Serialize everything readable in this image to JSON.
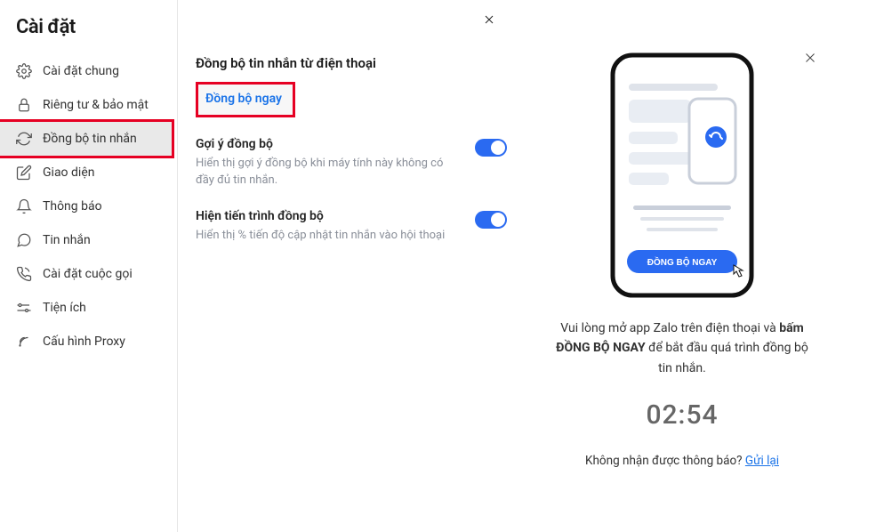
{
  "sidebar": {
    "title": "Cài đặt",
    "items": [
      {
        "label": "Cài đặt chung"
      },
      {
        "label": "Riêng tư & bảo mật"
      },
      {
        "label": "Đồng bộ tin nhắn"
      },
      {
        "label": "Giao diện"
      },
      {
        "label": "Thông báo"
      },
      {
        "label": "Tin nhắn"
      },
      {
        "label": "Cài đặt cuộc gọi"
      },
      {
        "label": "Tiện ích"
      },
      {
        "label": "Cấu hình Proxy"
      }
    ]
  },
  "main": {
    "heading": "Đồng bộ tin nhắn từ điện thoại",
    "sync_now_label": "Đồng bộ ngay",
    "suggest": {
      "title": "Gợi ý đồng bộ",
      "desc": "Hiển thị gợi ý đồng bộ khi máy tính này không có đầy đủ tin nhắn."
    },
    "progress": {
      "title": "Hiện tiến trình đồng bộ",
      "desc": "Hiển thị % tiến độ cập nhật tin nhắn vào hội thoại"
    }
  },
  "panel": {
    "phone_button_label": "ĐỒNG BỘ NGAY",
    "instruction_pre": "Vui lòng mở app Zalo trên điện thoại và ",
    "instruction_bold": "bấm ĐỒNG BỘ NGAY",
    "instruction_post": " để bắt đầu quá trình đồng bộ tin nhắn.",
    "timer": "02:54",
    "resend_pre": "Không nhận được thông báo? ",
    "resend_link": "Gửi lại"
  }
}
